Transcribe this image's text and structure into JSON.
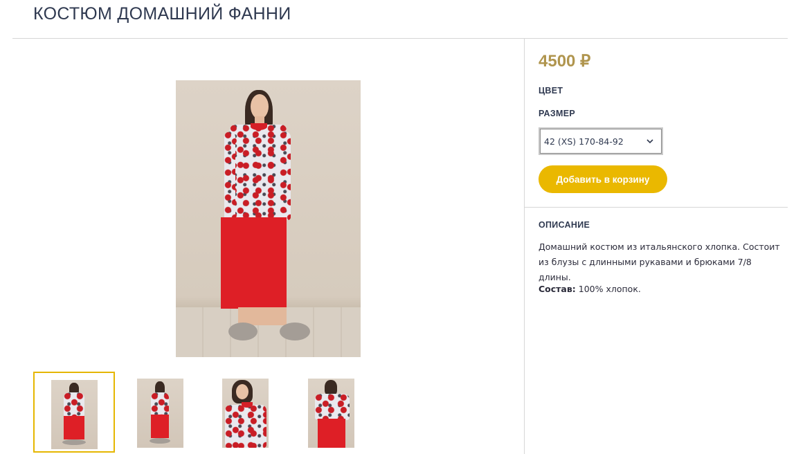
{
  "product": {
    "title": "КОСТЮМ ДОМАШНИЙ ФАННИ",
    "price": "4500 ₽",
    "color_label": "ЦВЕТ",
    "size_label": "РАЗМЕР",
    "size_selected": "42 (XS) 170-84-92",
    "add_to_cart": "Добавить в корзину",
    "description_label": "ОПИСАНИЕ",
    "description": "Домашний костюм из итальянского хлопка. Состоит из блузы  с длинными рукавами и брюками 7/8 длины.",
    "composition_label": "Состав:",
    "composition_value": "100% хлопок."
  },
  "gallery": {
    "thumbnails": [
      "thumb-1",
      "thumb-2",
      "thumb-3",
      "thumb-4"
    ],
    "active_index": 0
  },
  "colors": {
    "accent": "#eab800",
    "price": "#b0954e",
    "title": "#2f3950",
    "divider": "#d6d6d6"
  },
  "icons": {
    "select_arrow": "chevron-down-icon"
  }
}
